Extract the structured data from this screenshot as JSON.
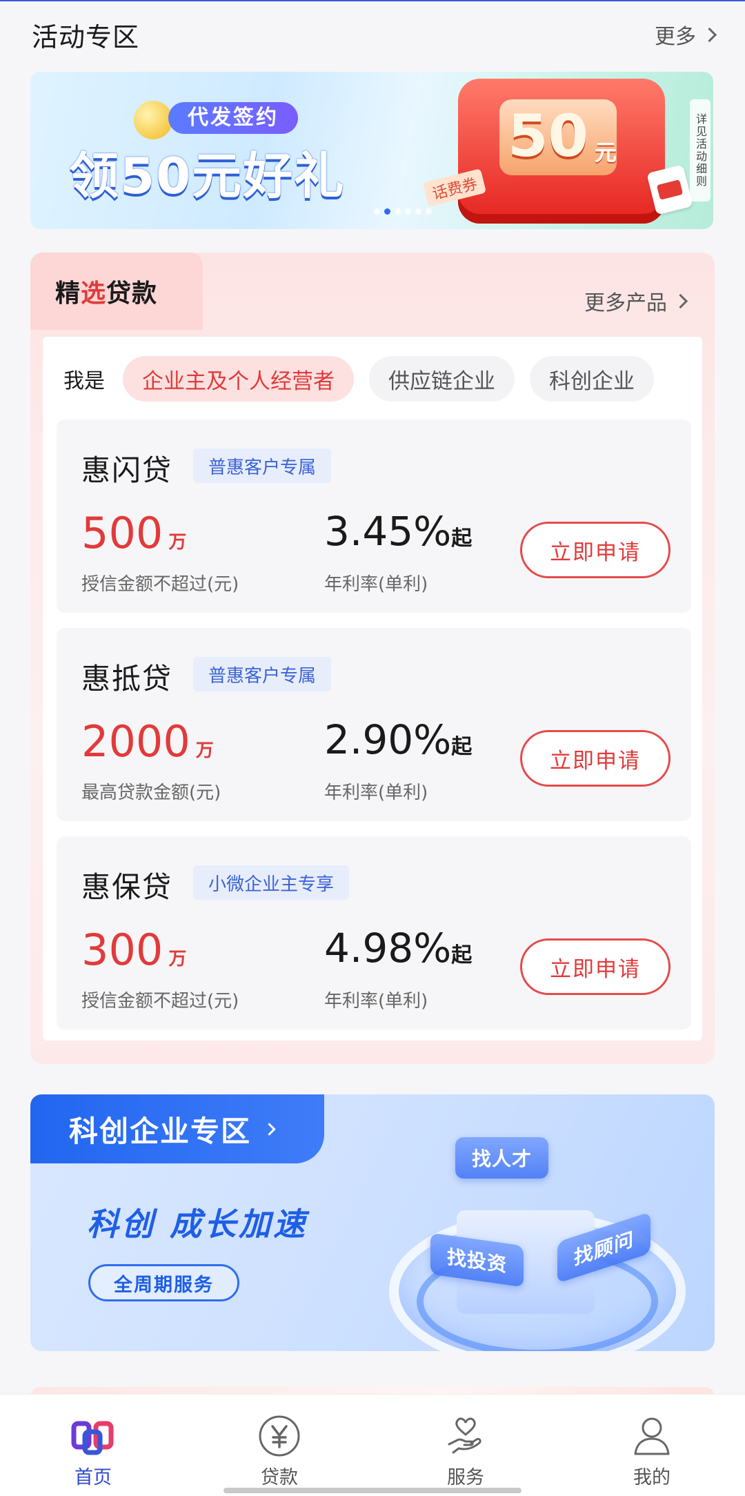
{
  "activity": {
    "title": "活动专区",
    "more": "更多"
  },
  "banner": {
    "pill": "代发签约",
    "headline": "领50元好礼",
    "amount": "50",
    "unit": "元",
    "ticket": "话费券",
    "side_note": "详见活动细则",
    "page_count": 6,
    "active_page": 2
  },
  "loans": {
    "title_prefix": "精",
    "title_highlight": "选",
    "title_suffix": "贷款",
    "more": "更多产品",
    "segment_label": "我是",
    "segments": [
      "企业主及个人经营者",
      "供应链企业",
      "科创企业"
    ],
    "active_segment": 0,
    "products": [
      {
        "name": "惠闪贷",
        "tag": "普惠客户专属",
        "amount": "500",
        "amount_unit": "万",
        "amount_label": "授信金额不超过(元)",
        "rate": "3.45%",
        "rate_suffix": "起",
        "rate_label": "年利率(单利)",
        "button": "立即申请"
      },
      {
        "name": "惠抵贷",
        "tag": "普惠客户专属",
        "amount": "2000",
        "amount_unit": "万",
        "amount_label": "最高贷款金额(元)",
        "rate": "2.90%",
        "rate_suffix": "起",
        "rate_label": "年利率(单利)",
        "button": "立即申请"
      },
      {
        "name": "惠保贷",
        "tag": "小微企业主专享",
        "amount": "300",
        "amount_unit": "万",
        "amount_label": "授信金额不超过(元)",
        "rate": "4.98%",
        "rate_suffix": "起",
        "rate_label": "年利率(单利)",
        "button": "立即申请"
      }
    ]
  },
  "science": {
    "title": "科创企业专区",
    "slogan": "科创 成长加速",
    "cycle": "全周期服务",
    "chips": [
      "找人才",
      "找投资",
      "找顾问"
    ]
  },
  "nav": {
    "items": [
      {
        "label": "首页",
        "icon": "home-logo-icon",
        "active": true
      },
      {
        "label": "贷款",
        "icon": "yen-circle-icon",
        "active": false
      },
      {
        "label": "服务",
        "icon": "heart-hand-icon",
        "active": false
      },
      {
        "label": "我的",
        "icon": "person-icon",
        "active": false
      }
    ]
  },
  "colors": {
    "accent_red": "#e23a3a",
    "accent_blue": "#2266f0",
    "nav_active": "#2d48c9"
  }
}
